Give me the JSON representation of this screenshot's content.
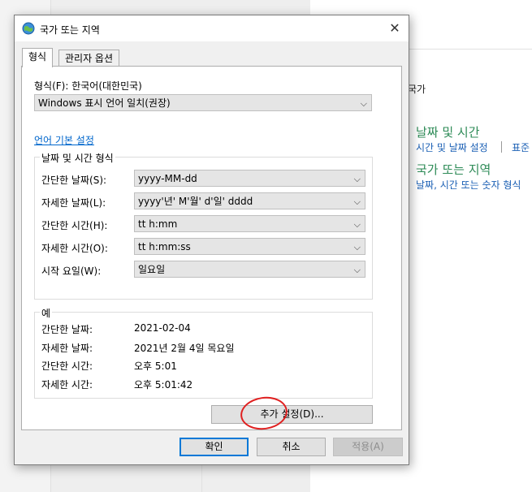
{
  "background": {
    "breadcrumb_fragment": "국가",
    "categories": [
      {
        "title": "날짜 및 시간",
        "link1": "시간 및 날짜 설정",
        "link2": "표준"
      },
      {
        "title": "국가 또는 지역",
        "link1": "날짜, 시간 또는 숫자 형식"
      }
    ]
  },
  "dialog": {
    "title": "국가 또는 지역",
    "tabs": [
      {
        "label": "형식",
        "active": true
      },
      {
        "label": "관리자 옵션",
        "active": false
      }
    ],
    "format_label": "형식(F): 한국어(대한민국)",
    "format_select": "Windows 표시 언어 일치(권장)",
    "language_pref_link": "언어 기본 설정",
    "date_time_group": {
      "title": "날짜 및 시간 형식",
      "rows": [
        {
          "label": "간단한 날짜(S):",
          "value": "yyyy-MM-dd"
        },
        {
          "label": "자세한 날짜(L):",
          "value": "yyyy'년' M'월' d'일' dddd"
        },
        {
          "label": "간단한 시간(H):",
          "value": "tt h:mm"
        },
        {
          "label": "자세한 시간(O):",
          "value": "tt h:mm:ss"
        },
        {
          "label": "시작 요일(W):",
          "value": "일요일"
        }
      ]
    },
    "example_group": {
      "title": "예",
      "rows": [
        {
          "label": "간단한 날짜:",
          "value": "2021-02-04"
        },
        {
          "label": "자세한 날짜:",
          "value": "2021년 2월 4일 목요일"
        },
        {
          "label": "간단한 시간:",
          "value": "오후 5:01"
        },
        {
          "label": "자세한 시간:",
          "value": "오후 5:01:42"
        }
      ]
    },
    "additional_settings_button": "추가 설정(D)...",
    "ok_button": "확인",
    "cancel_button": "취소",
    "apply_button": "적용(A)",
    "close_glyph": "✕",
    "chevron_glyph": "⌵"
  },
  "colors": {
    "link_blue": "#0066cc",
    "category_green": "#2e8b57",
    "primary_border": "#0078d7",
    "annotation_red": "#e02020"
  }
}
